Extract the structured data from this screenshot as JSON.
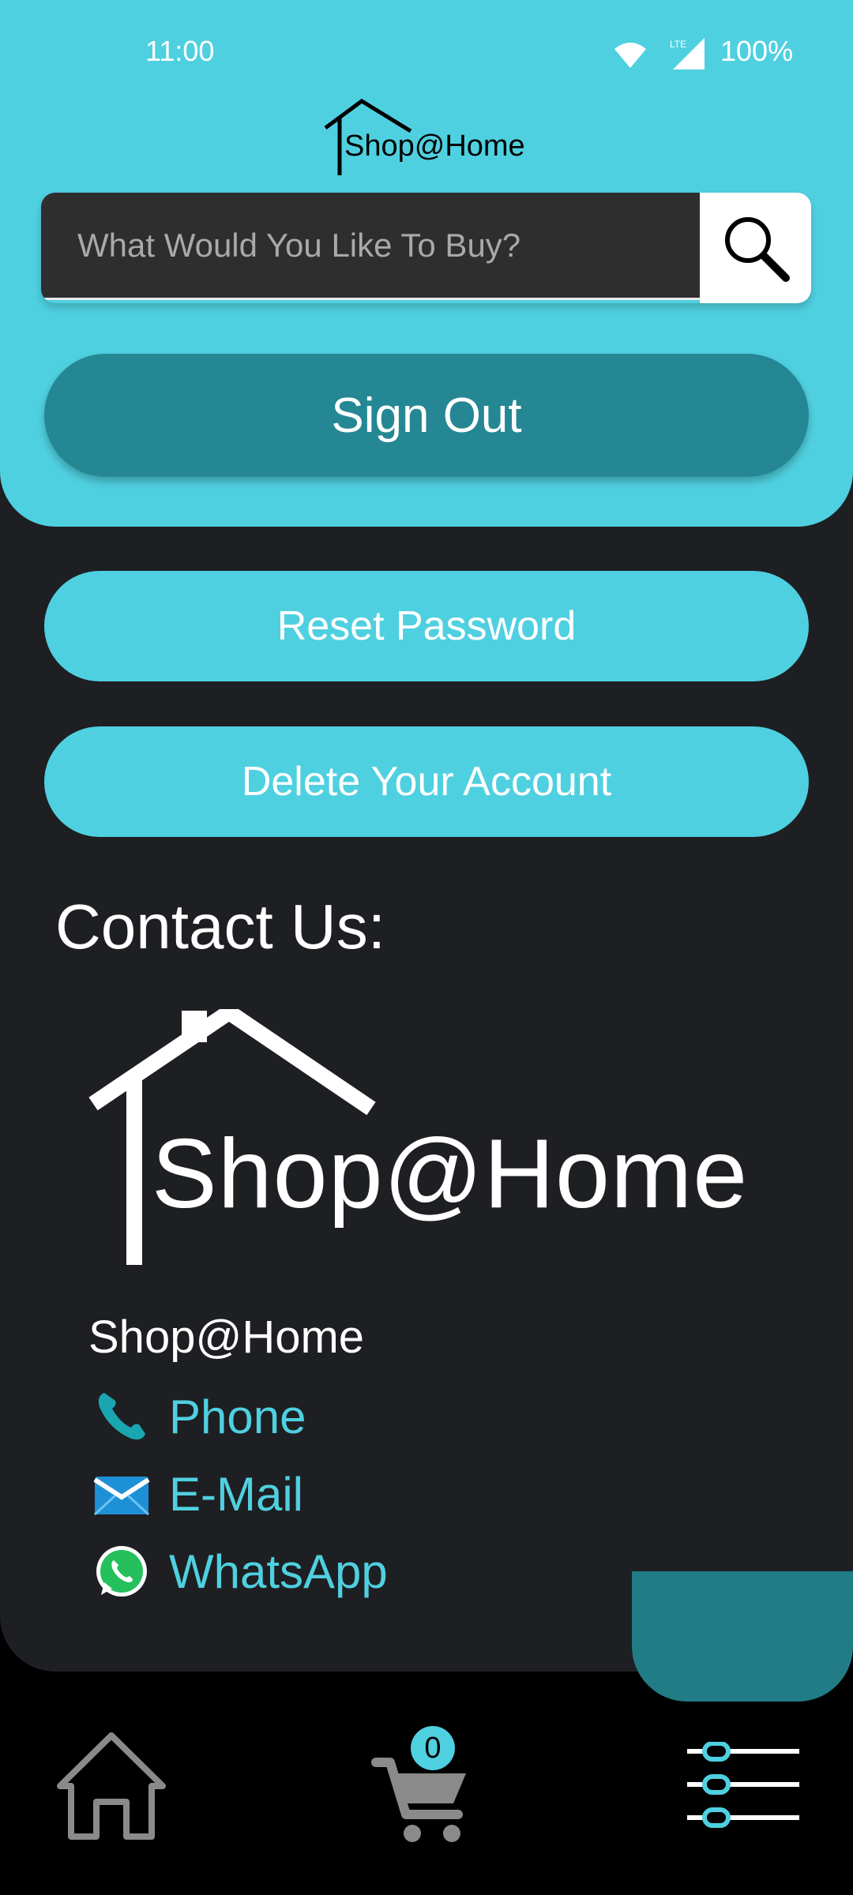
{
  "status_bar": {
    "time": "11:00",
    "battery": "100%",
    "network": "LTE"
  },
  "brand": {
    "name": "Shop@Home"
  },
  "search": {
    "placeholder": "What Would You Like To Buy?"
  },
  "buttons": {
    "sign_out": "Sign Out",
    "reset_password": "Reset Password",
    "delete_account": "Delete Your Account"
  },
  "contact": {
    "title": "Contact Us:",
    "company": "Shop@Home",
    "items": [
      {
        "label": "Phone",
        "icon": "phone-icon"
      },
      {
        "label": "E-Mail",
        "icon": "envelope-icon"
      },
      {
        "label": "WhatsApp",
        "icon": "whatsapp-icon"
      }
    ]
  },
  "nav": {
    "cart_count": "0",
    "items": [
      "home-icon",
      "cart-icon",
      "menu-icon"
    ]
  },
  "colors": {
    "accent": "#4fd0e0",
    "dark_accent": "#258794",
    "panel": "#1e1f22",
    "background": "#000000"
  }
}
